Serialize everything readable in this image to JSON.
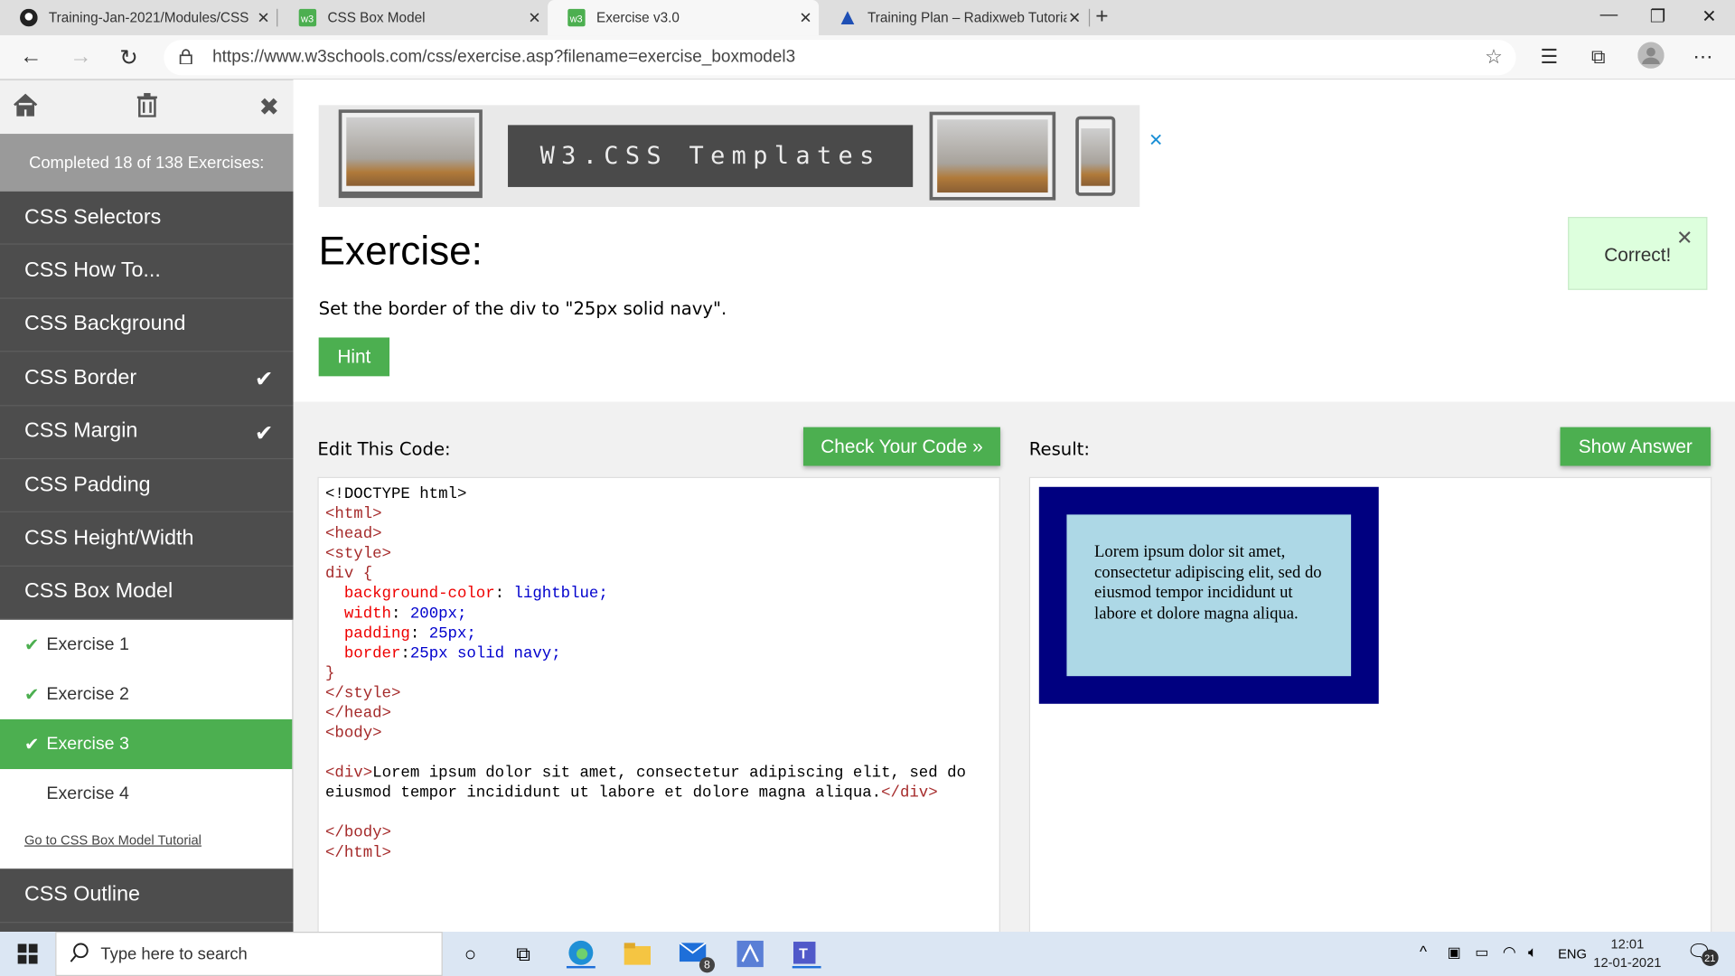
{
  "browser": {
    "tabs": [
      {
        "title": "Training-Jan-2021/Modules/CSS"
      },
      {
        "title": "CSS Box Model"
      },
      {
        "title": "Exercise v3.0"
      },
      {
        "title": "Training Plan – Radixweb Tutoria"
      }
    ],
    "url": "https://www.w3schools.com/css/exercise.asp?filename=exercise_boxmodel3"
  },
  "sidebar": {
    "progress": "Completed 18 of 138 Exercises:",
    "items": [
      {
        "label": "CSS Selectors"
      },
      {
        "label": "CSS How To..."
      },
      {
        "label": "CSS Background"
      },
      {
        "label": "CSS Border",
        "done": "✔"
      },
      {
        "label": "CSS Margin",
        "done": "✔"
      },
      {
        "label": "CSS Padding"
      },
      {
        "label": "CSS Height/Width"
      },
      {
        "label": "CSS Box Model"
      }
    ],
    "exercises": [
      "Exercise 1",
      "Exercise 2",
      "Exercise 3",
      "Exercise 4"
    ],
    "tutorial_link": "Go to CSS Box Model Tutorial",
    "after": "CSS Outline"
  },
  "ad": {
    "text": "W3.CSS Templates"
  },
  "exercise": {
    "title": "Exercise:",
    "description": "Set the border of the div to \"25px solid navy\".",
    "hint": "Hint",
    "feedback": "Correct!"
  },
  "editor": {
    "label": "Edit This Code:",
    "check_button": "Check Your Code »",
    "result_label": "Result:",
    "show_answer": "Show Answer"
  },
  "code": {
    "l1": "<!DOCTYPE html>",
    "l2": "<html>",
    "l3": "<head>",
    "l4": "<style>",
    "l5": "div {",
    "p1": "background-color",
    "v1": "lightblue;",
    "p2": "width",
    "v2": "200px;",
    "p3": "padding",
    "v3": "25px;",
    "p4": "border",
    "v4": "25px solid navy;",
    "l10": "}",
    "l11": "</style>",
    "l12": "</head>",
    "l13": "<body>",
    "div_open": "<div>",
    "div_text1": "Lorem ipsum dolor sit amet, consectetur adipiscing elit, sed do",
    "div_text2": "eiusmod tempor incididunt ut labore et dolore magna aliqua.",
    "div_close": "</div>",
    "l16": "</body>",
    "l17": "</html>"
  },
  "result": {
    "text": "Lorem ipsum dolor sit amet, consectetur adipiscing elit, sed do eiusmod tempor incididunt ut labore et dolore magna aliqua."
  },
  "taskbar": {
    "search_placeholder": "Type here to search",
    "mail_badge": "8",
    "lang": "ENG",
    "time": "12:01",
    "date": "12-01-2021",
    "notif": "21"
  },
  "colors": {
    "accent": "#4CAF50",
    "sidebar": "#4d4d4d",
    "result_border": "#000080",
    "result_bg": "lightblue"
  }
}
